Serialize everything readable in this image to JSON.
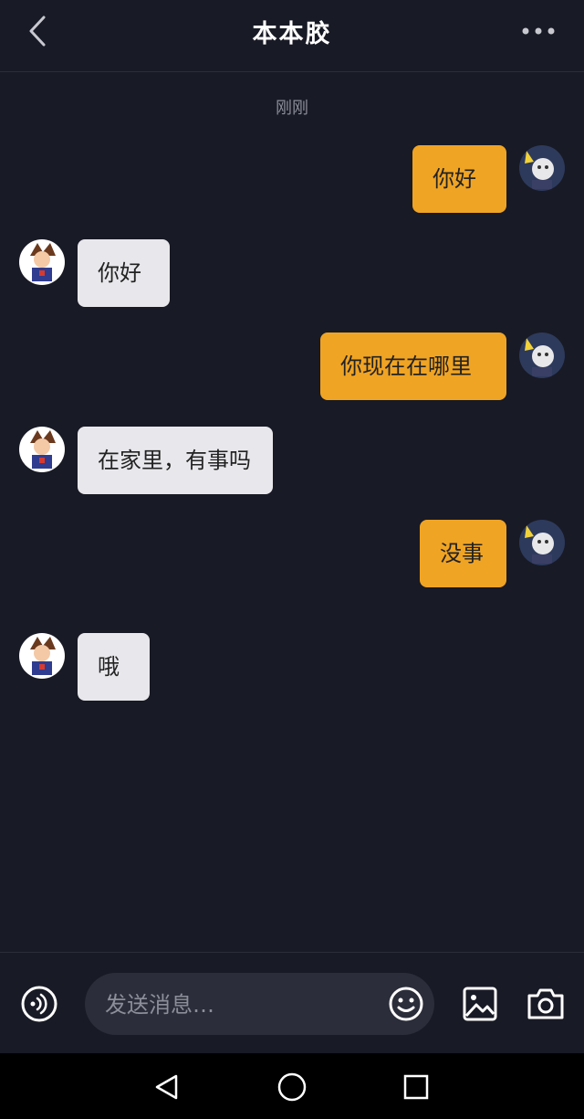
{
  "header": {
    "title": "本本胶",
    "back_icon": "chevron-left-icon",
    "more_icon": "more-dots-icon"
  },
  "chat": {
    "timestamp": "刚刚",
    "messages": [
      {
        "direction": "sent",
        "text": "你好"
      },
      {
        "direction": "received",
        "text": "你好"
      },
      {
        "direction": "sent",
        "text": "你现在在哪里"
      },
      {
        "direction": "received",
        "text": "在家里，有事吗"
      },
      {
        "direction": "sent",
        "text": "没事"
      },
      {
        "direction": "received",
        "text": "哦"
      }
    ]
  },
  "input_bar": {
    "placeholder": "发送消息…",
    "value": "",
    "icons": [
      "voice-icon",
      "emoji-icon",
      "image-icon",
      "camera-icon"
    ]
  },
  "nav": {
    "icons": [
      "nav-back-icon",
      "nav-home-icon",
      "nav-recent-icon"
    ]
  },
  "colors": {
    "background": "#181a25",
    "sent_bubble": "#f0a424",
    "received_bubble": "#e8e8ec"
  }
}
